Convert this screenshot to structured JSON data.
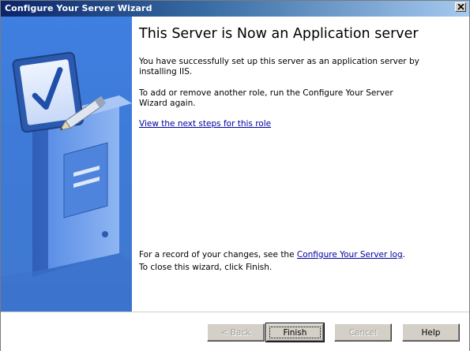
{
  "window": {
    "title": "Configure Your Server Wizard"
  },
  "main": {
    "heading": "This Server is Now an Application server",
    "para1": "You have successfully set up this server as an application server by installing IIS.",
    "para2": "To add or remove another role, run the Configure Your Server Wizard again.",
    "next_steps_link": "View the next steps for this role",
    "record_prefix": "For a record of your changes, see the ",
    "record_link": "Configure Your Server log",
    "record_suffix": ".",
    "close_text": "To close this wizard, click Finish."
  },
  "buttons": {
    "back": "< Back",
    "finish": "Finish",
    "cancel": "Cancel",
    "help": "Help"
  },
  "colors": {
    "titlebar_start": "#0a246a",
    "sidepanel": "#3f7fe0",
    "link": "#0000a0"
  },
  "icons": {
    "close": "close-icon",
    "illustration": "server-checkmark-illustration"
  }
}
